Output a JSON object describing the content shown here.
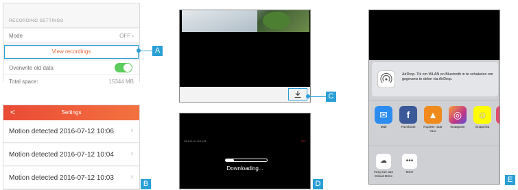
{
  "panelA": {
    "section_header": "RECORDING SETTINGS",
    "mode_label": "Mode",
    "mode_value": "OFF",
    "view_recordings": "View recordings",
    "overwrite_label": "Overwrite old data",
    "overwrite_on": true,
    "total_space_label": "Total space:",
    "total_space_value": "15344 MB",
    "badge": "A"
  },
  "panelB": {
    "title": "Settings",
    "back": "<",
    "items": [
      "Motion detected 2016-07-12 10:06",
      "Motion detected 2016-07-12 10:04",
      "Motion detected 2016-07-12 10:03"
    ],
    "badge": "B"
  },
  "panelC": {
    "download_icon": "download-icon",
    "badge": "C"
  },
  "panelD": {
    "osd_left": "2016-01-01 00:15:28",
    "osd_right": "REC",
    "downloading": "Downloading...",
    "progress": 0.2,
    "badge": "D"
  },
  "panelE": {
    "airdrop_text": "AirDrop. Tik om WLAN en Bluetooth in te schakelen om gegevens te delen via AirDrop.",
    "apps": [
      {
        "label": "Mail",
        "icon": "mail-icon",
        "color": "#2d8cf0"
      },
      {
        "label": "Facebook",
        "icon": "facebook-icon",
        "color": "#3b5998"
      },
      {
        "label": "Kopieer naar VLC",
        "icon": "vlc-icon",
        "color": "#f08a1c"
      },
      {
        "label": "Instagram",
        "icon": "instagram-icon",
        "color": "#c13584"
      },
      {
        "label": "Snapchat",
        "icon": "snapchat-icon",
        "color": "#fffc00"
      }
    ],
    "actions": [
      {
        "label": "Voeg toe aan iCloud Drive",
        "icon": "icloud-upload-icon"
      },
      {
        "label": "Meer",
        "icon": "more-icon"
      }
    ],
    "badge": "E"
  },
  "colors": {
    "accent": "#2a9fd6",
    "orange": "#e56a3a",
    "toggle": "#5ccc5c"
  }
}
